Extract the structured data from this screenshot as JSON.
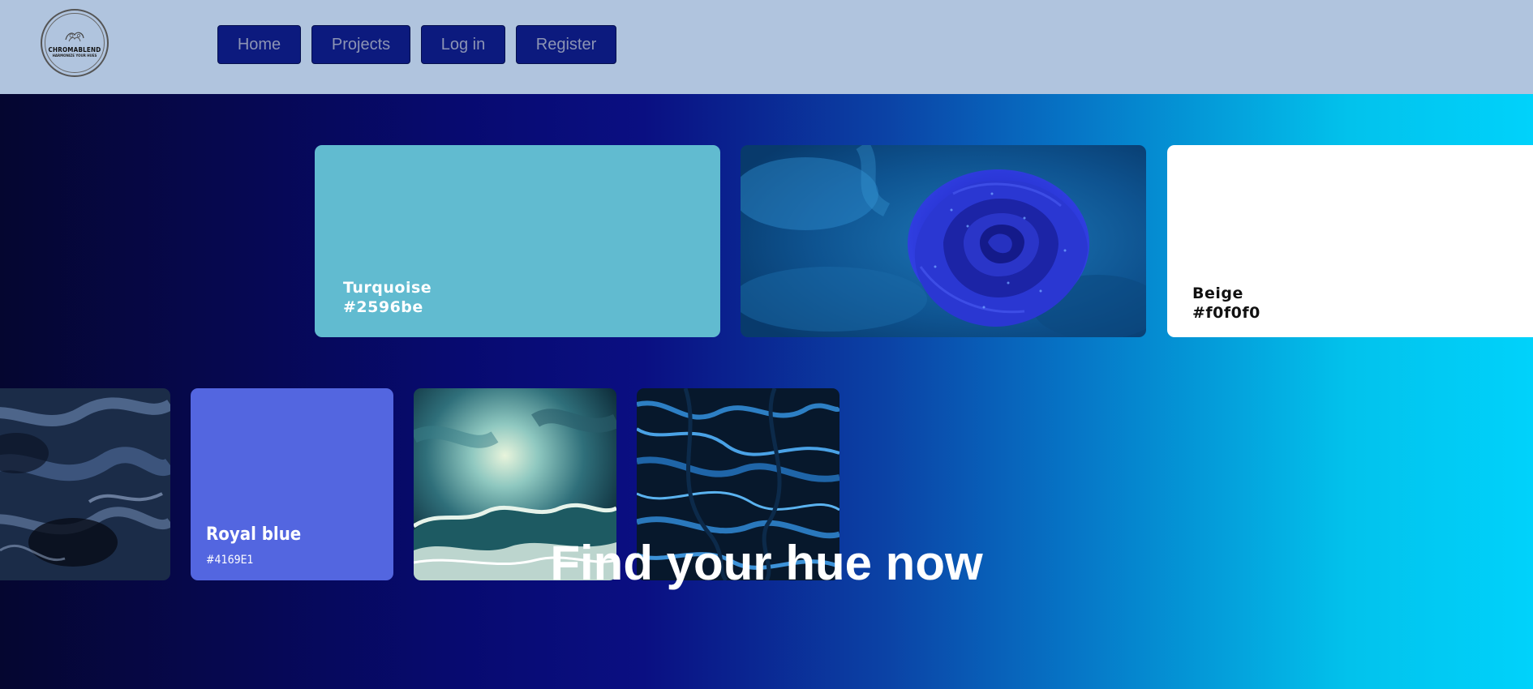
{
  "brand": {
    "name": "CHROMABLEND",
    "tagline": "HARMONIZE YOUR HUES"
  },
  "nav": {
    "items": [
      {
        "label": "Home"
      },
      {
        "label": "Projects"
      },
      {
        "label": "Log in"
      },
      {
        "label": "Register"
      }
    ]
  },
  "gallery": {
    "row1": [
      {
        "kind": "swatch",
        "name": "Turquoise",
        "hex": "#2596be"
      },
      {
        "kind": "image",
        "icon": "blue-rose-photo"
      },
      {
        "kind": "swatch",
        "name": "Beige",
        "hex": "#f0f0f0"
      }
    ],
    "row2": [
      {
        "kind": "image",
        "icon": "blue-smoke-photo"
      },
      {
        "kind": "swatch",
        "name": "Royal blue",
        "hex": "#4169E1"
      },
      {
        "kind": "image",
        "icon": "ocean-wave-painting"
      },
      {
        "kind": "image",
        "icon": "blue-marble-texture"
      }
    ]
  },
  "hero": {
    "headline": "Find your hue now"
  },
  "colors": {
    "header_bg": "#b0c4de",
    "nav_button_bg": "#0c1a7e",
    "nav_button_text": "#8c94b4",
    "turquoise_card": "#61bbd0",
    "royal_blue_card": "#5366e0",
    "beige_card": "#ffffff",
    "gradient_start": "#050630",
    "gradient_end": "#00d2fb"
  }
}
